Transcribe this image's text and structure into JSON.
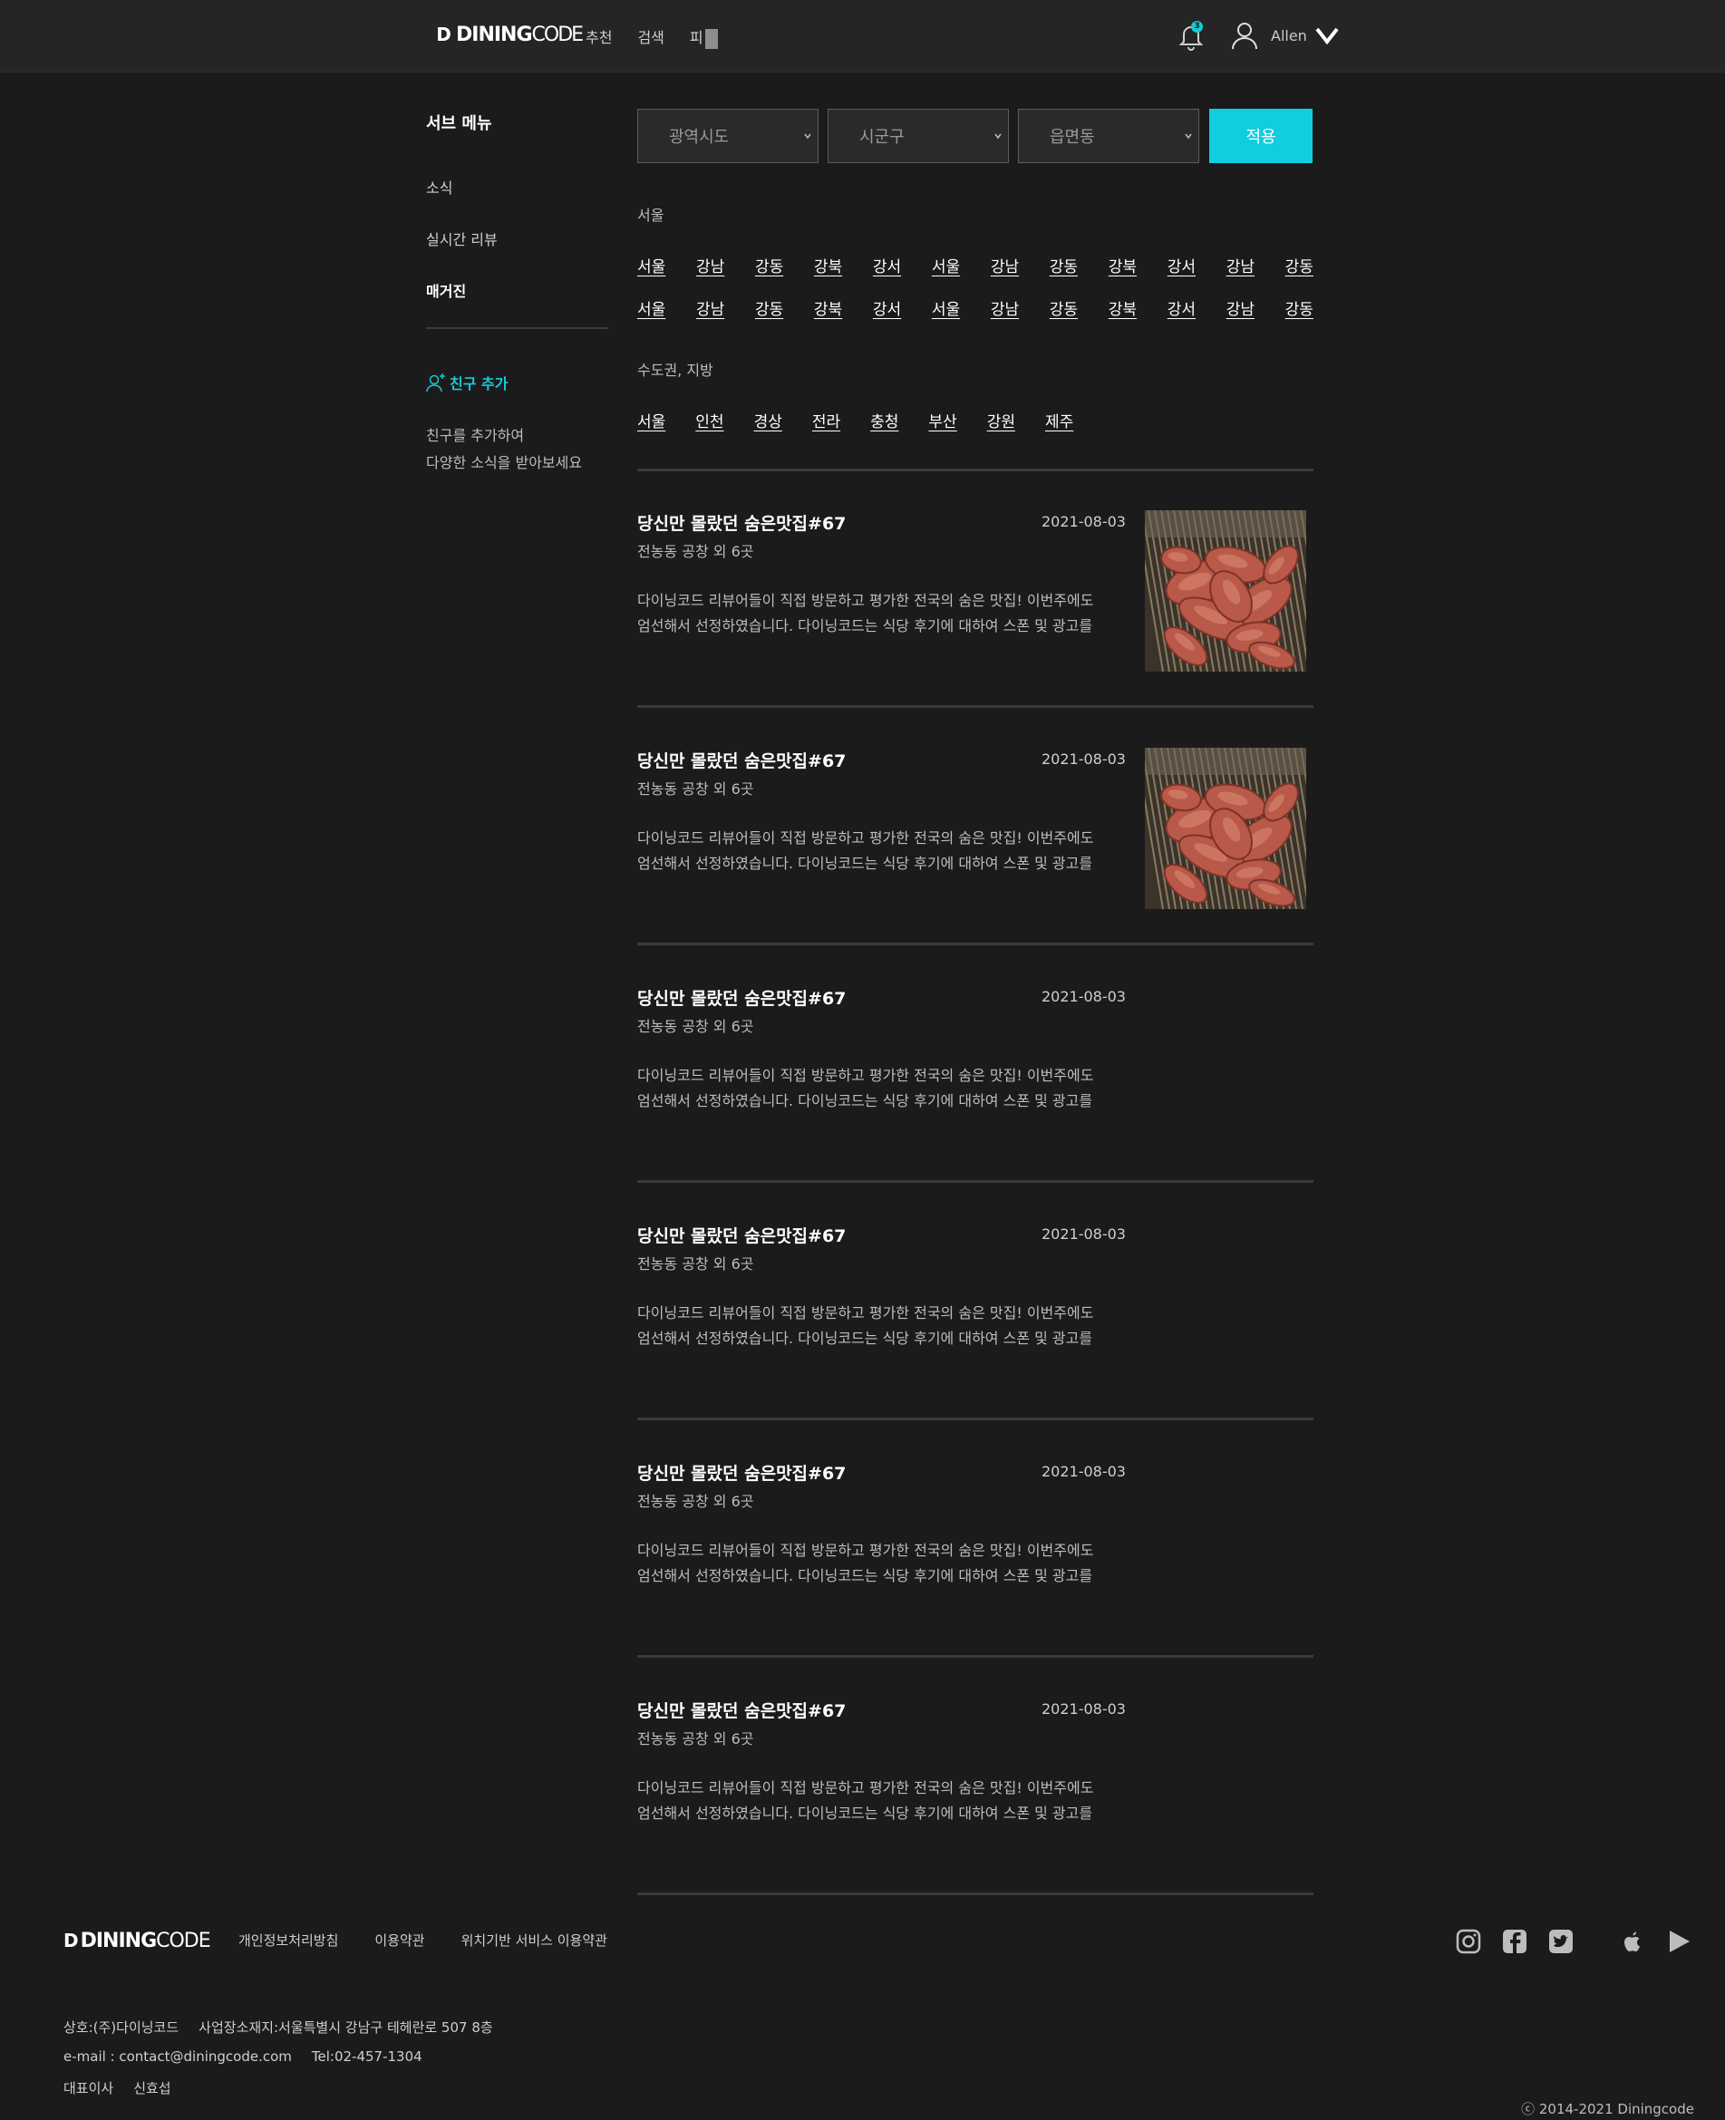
{
  "header": {
    "logo_mark": "D",
    "logo_bold": "DINING",
    "logo_light": "CODE",
    "nav": [
      "추천",
      "검색",
      "피"
    ],
    "notification_count": "3",
    "user_name": "Allen"
  },
  "sidebar": {
    "title": "서브 메뉴",
    "items": [
      "소식",
      "실시간 리뷰",
      "매거진"
    ],
    "friend_add_label": "친구 추가",
    "friend_desc_line1": "친구를 추가하여",
    "friend_desc_line2": "다양한 소식을 받아보세요"
  },
  "filters": {
    "selects": [
      "광역시도",
      "시군구",
      "읍면동"
    ],
    "apply_label": "적용"
  },
  "regions": {
    "seoul_title": "서울",
    "seoul_row1": [
      "서울",
      "강남",
      "강동",
      "강북",
      "강서",
      "서울",
      "강남",
      "강동",
      "강북",
      "강서",
      "강남",
      "강동"
    ],
    "seoul_row2": [
      "서울",
      "강남",
      "강동",
      "강북",
      "강서",
      "서울",
      "강남",
      "강동",
      "강북",
      "강서",
      "강남",
      "강동"
    ],
    "metro_title": "수도권, 지방",
    "metro_row": [
      "서울",
      "인천",
      "경상",
      "전라",
      "충청",
      "부산",
      "강원",
      "제주"
    ]
  },
  "articles": [
    {
      "title": "당신만 몰랐던 숨은맛집#67",
      "date": "2021-08-03",
      "sub": "전농동 공창 외 6곳",
      "line1": "다이닝코드 리뷰어들이 직접 방문하고 평가한 전국의 숨은 맛집! 이번주에도",
      "line2": "엄선해서 선정하였습니다. 다이닝코드는 식당 후기에 대하여 스폰 및 광고를",
      "has_image": true
    },
    {
      "title": "당신만 몰랐던 숨은맛집#67",
      "date": "2021-08-03",
      "sub": "전농동 공창 외 6곳",
      "line1": "다이닝코드 리뷰어들이 직접 방문하고 평가한 전국의 숨은 맛집! 이번주에도",
      "line2": "엄선해서 선정하였습니다. 다이닝코드는 식당 후기에 대하여 스폰 및 광고를",
      "has_image": true
    },
    {
      "title": "당신만 몰랐던 숨은맛집#67",
      "date": "2021-08-03",
      "sub": "전농동 공창 외 6곳",
      "line1": "다이닝코드 리뷰어들이 직접 방문하고 평가한 전국의 숨은 맛집! 이번주에도",
      "line2": "엄선해서 선정하였습니다. 다이닝코드는 식당 후기에 대하여 스폰 및 광고를",
      "has_image": false
    },
    {
      "title": "당신만 몰랐던 숨은맛집#67",
      "date": "2021-08-03",
      "sub": "전농동 공창 외 6곳",
      "line1": "다이닝코드 리뷰어들이 직접 방문하고 평가한 전국의 숨은 맛집! 이번주에도",
      "line2": "엄선해서 선정하였습니다. 다이닝코드는 식당 후기에 대하여 스폰 및 광고를",
      "has_image": false
    },
    {
      "title": "당신만 몰랐던 숨은맛집#67",
      "date": "2021-08-03",
      "sub": "전농동 공창 외 6곳",
      "line1": "다이닝코드 리뷰어들이 직접 방문하고 평가한 전국의 숨은 맛집! 이번주에도",
      "line2": "엄선해서 선정하였습니다. 다이닝코드는 식당 후기에 대하여 스폰 및 광고를",
      "has_image": false
    },
    {
      "title": "당신만 몰랐던 숨은맛집#67",
      "date": "2021-08-03",
      "sub": "전농동 공창 외 6곳",
      "line1": "다이닝코드 리뷰어들이 직접 방문하고 평가한 전국의 숨은 맛집! 이번주에도",
      "line2": "엄선해서 선정하였습니다. 다이닝코드는 식당 후기에 대하여 스폰 및 광고를",
      "has_image": false
    }
  ],
  "footer": {
    "links": [
      "개인정보처리방침",
      "이용약관",
      "위치기반 서비스 이용약관"
    ],
    "social_icons": [
      "instagram-icon",
      "facebook-icon",
      "twitter-icon",
      "apple-icon",
      "google-play-icon"
    ],
    "company": "상호:(주)다이닝코드",
    "address": "사업장소재지:서울특별시 강남구 테헤란로 507 8층",
    "email": "e-mail : contact@diningcode.com",
    "tel": "Tel:02-457-1304",
    "ceo_label": "대표이사",
    "ceo_name": "신효섭",
    "copyright": "ⓒ 2014-2021 Diningcode"
  },
  "colors": {
    "accent": "#12cde0",
    "background": "#1b1b1b",
    "header": "#252525"
  }
}
